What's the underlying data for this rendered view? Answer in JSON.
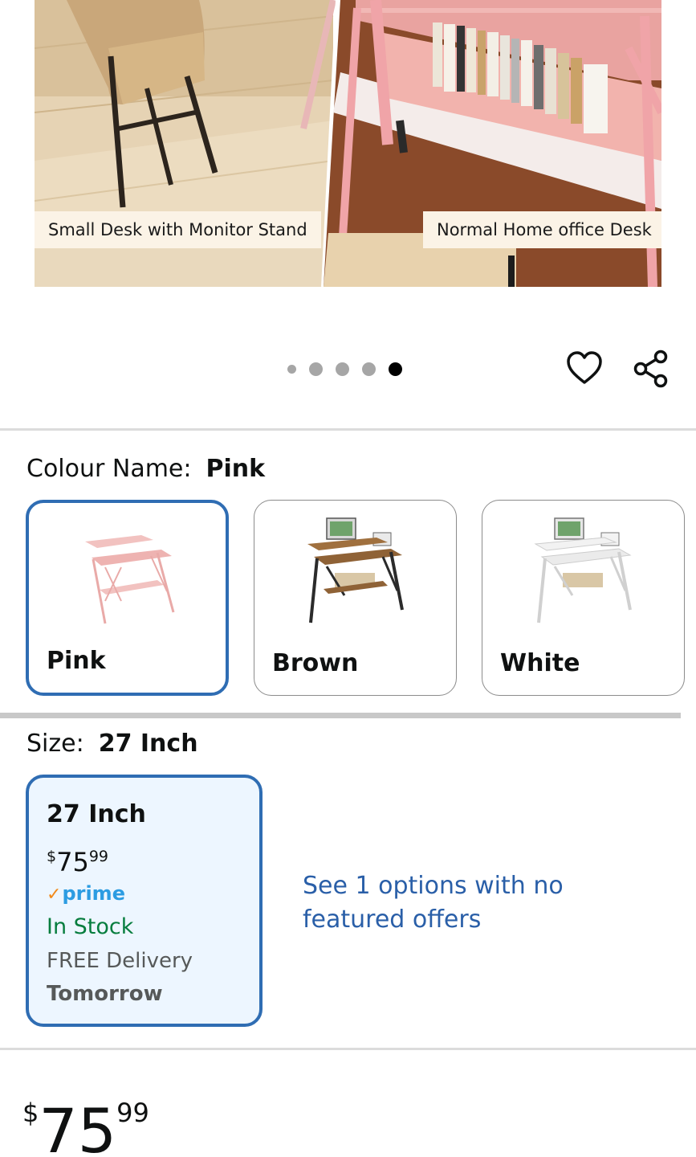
{
  "hero": {
    "label_left": "Small Desk with Monitor Stand",
    "label_right": "Normal Home office Desk",
    "carousel_total": 5,
    "carousel_active": 5
  },
  "colour": {
    "label": "Colour Name:",
    "selected": "Pink",
    "options": [
      {
        "name": "Pink",
        "selected": true
      },
      {
        "name": "Brown",
        "selected": false
      },
      {
        "name": "White",
        "selected": false
      }
    ]
  },
  "size": {
    "label": "Size:",
    "selected": "27 Inch",
    "card": {
      "title": "27 Inch",
      "price_symbol": "$",
      "price_whole": "75",
      "price_fraction": "99",
      "prime_check": "✓",
      "prime_label": "prime",
      "stock": "In Stock",
      "delivery": "FREE Delivery",
      "delivery_day": "Tomorrow"
    },
    "see_options_link": "See 1 options with no featured offers"
  },
  "price": {
    "symbol": "$",
    "whole": "75",
    "fraction": "99"
  },
  "colors": {
    "accent_border": "#2f6db3",
    "link": "#2a5fa8",
    "in_stock": "#067d3e",
    "prime": "#2c9ce2",
    "selected_bg": "#edf6ff"
  },
  "icons": {
    "wishlist": "heart-icon",
    "share": "share-icon"
  }
}
